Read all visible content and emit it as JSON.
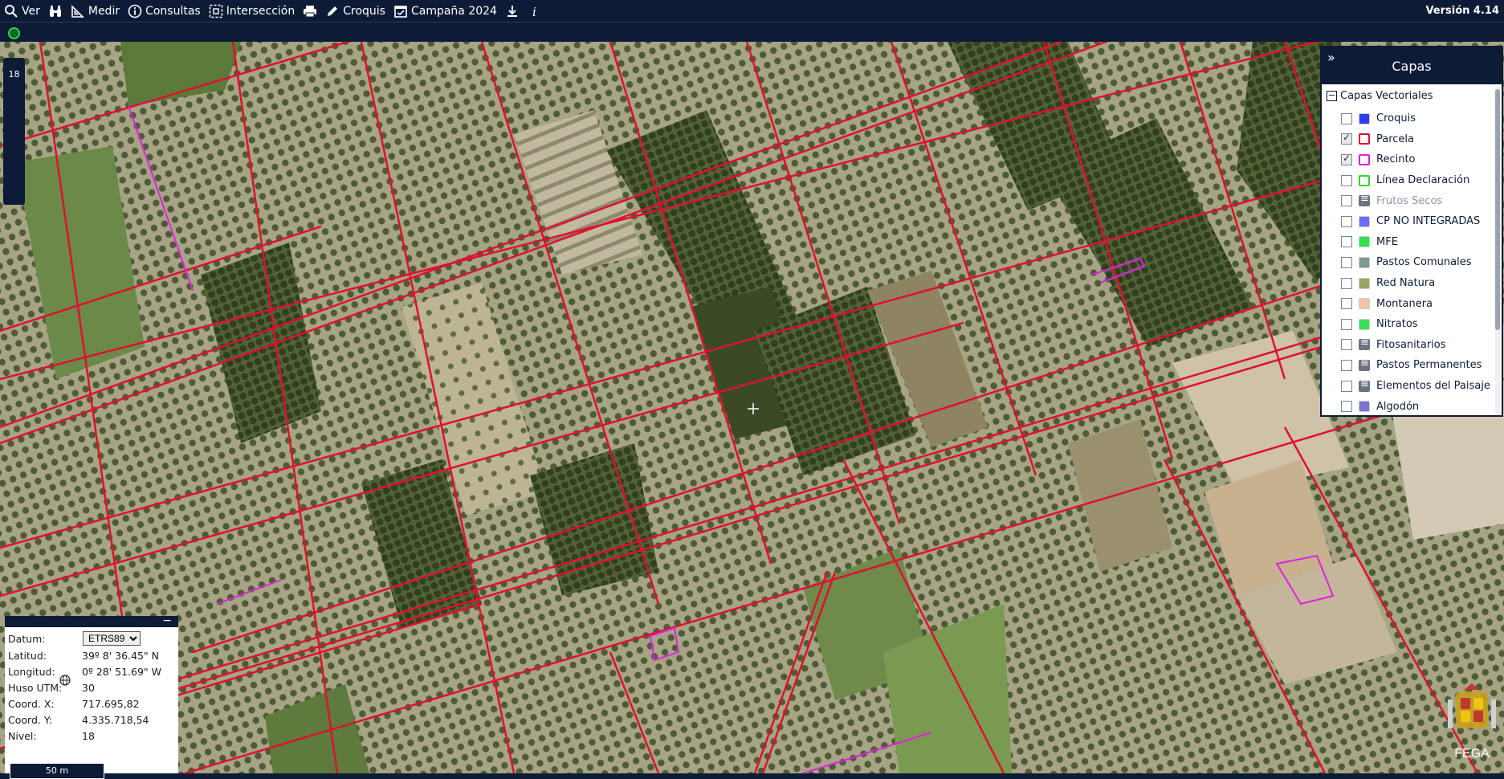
{
  "toolbar": {
    "items": [
      {
        "label": "Ver",
        "icon": "search-icon"
      },
      {
        "label": "",
        "icon": "binoculars-icon"
      },
      {
        "label": "Medir",
        "icon": "ruler-icon"
      },
      {
        "label": "Consultas",
        "icon": "info-icon"
      },
      {
        "label": "Intersección",
        "icon": "intersection-icon"
      },
      {
        "label": "",
        "icon": "print-icon"
      },
      {
        "label": "Croquis",
        "icon": "pencil-icon"
      },
      {
        "label": "Campaña 2024",
        "icon": "calendar-icon"
      },
      {
        "label": "",
        "icon": "download-icon"
      },
      {
        "label": "",
        "icon": "italic-info-icon"
      }
    ],
    "version": "Versión 4.14"
  },
  "zoom_level": "18",
  "layers": {
    "title": "Capas",
    "group_label": "Capas Vectoriales",
    "items": [
      {
        "label": "Croquis",
        "checked": false,
        "color": "#2f3ef0",
        "style": "fill"
      },
      {
        "label": "Parcela",
        "checked": true,
        "color": "#e0102f",
        "style": "outline"
      },
      {
        "label": "Recinto",
        "checked": true,
        "color": "#e020e0",
        "style": "outline"
      },
      {
        "label": "Línea Declaración",
        "checked": false,
        "color": "#39d42d",
        "style": "outline"
      },
      {
        "label": "Frutos Secos",
        "checked": false,
        "color": "#6b7280",
        "style": "list",
        "disabled": true
      },
      {
        "label": "CP NO INTEGRADAS",
        "checked": false,
        "color": "#6c6cf5",
        "style": "fill"
      },
      {
        "label": "MFE",
        "checked": false,
        "color": "#2ee04a",
        "style": "fill"
      },
      {
        "label": "Pastos Comunales",
        "checked": false,
        "color": "#7e9a8c",
        "style": "fill"
      },
      {
        "label": "Red Natura",
        "checked": false,
        "color": "#9aa460",
        "style": "fill"
      },
      {
        "label": "Montanera",
        "checked": false,
        "color": "#f4c2a6",
        "style": "fill"
      },
      {
        "label": "Nitratos",
        "checked": false,
        "color": "#3be05a",
        "style": "fill"
      },
      {
        "label": "Fitosanitarios",
        "checked": false,
        "color": "#6b7280",
        "style": "list"
      },
      {
        "label": "Pastos Permanentes",
        "checked": false,
        "color": "#6b7280",
        "style": "list"
      },
      {
        "label": "Elementos del Paisaje",
        "checked": false,
        "color": "#6b7280",
        "style": "list"
      },
      {
        "label": "Algodón",
        "checked": false,
        "color": "#7c72d8",
        "style": "fill"
      }
    ]
  },
  "coords": {
    "datum_label": "Datum:",
    "datum_value": "ETRS89",
    "lat_label": "Latitud:",
    "lat_value": "39º 8' 36.45\" N",
    "lon_label": "Longitud:",
    "lon_value": "0º 28' 51.69\" W",
    "huso_label": "Huso UTM:",
    "huso_value": "30",
    "x_label": "Coord. X:",
    "x_value": "717.695,82",
    "y_label": "Coord. Y:",
    "y_value": "4.335.718,54",
    "nivel_label": "Nivel:",
    "nivel_value": "18",
    "scale_label": "50 m"
  },
  "brand": "FEGA"
}
